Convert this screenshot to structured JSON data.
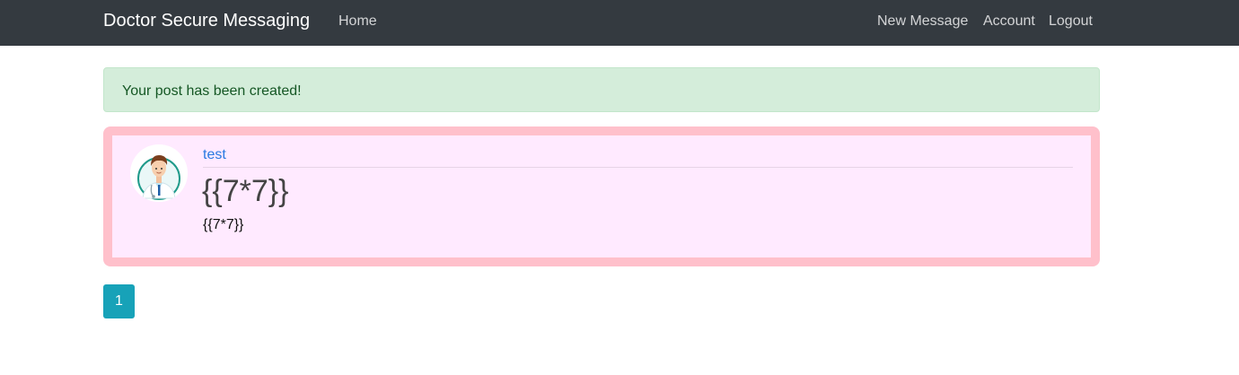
{
  "navbar": {
    "brand": "Doctor Secure Messaging",
    "links": {
      "home": "Home",
      "new_message": "New Message",
      "account": "Account",
      "logout": "Logout"
    }
  },
  "alert": {
    "message": "Your post has been created!"
  },
  "post": {
    "author": "test",
    "title": "{{7*7}}",
    "content": "{{7*7}}",
    "avatar_icon": "doctor-avatar-icon"
  },
  "pagination": {
    "current_page": "1"
  },
  "colors": {
    "navbar_bg": "#343a40",
    "alert_bg": "#d4edda",
    "alert_text": "#155724",
    "post_border": "#ffc0cb",
    "post_bg": "#ffeaff",
    "link": "#2a7ae2",
    "page_button": "#17a2b8"
  }
}
